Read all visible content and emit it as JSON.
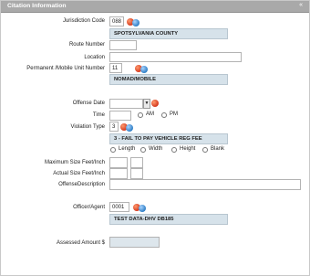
{
  "panel": {
    "title": "Citation Information",
    "toggle": "«"
  },
  "jurisdiction": {
    "label": "Jurisdiction Code",
    "code": "088",
    "name": "SPOTSYLVANIA COUNTY"
  },
  "route": {
    "label": "Route Number",
    "value": ""
  },
  "location": {
    "label": "Location",
    "value": ""
  },
  "unit": {
    "label": "Permanent /Mobile Unit Number",
    "code": "11",
    "name": "NOMAD/MOBILE"
  },
  "offense_date": {
    "label": "Offense Date",
    "value": ""
  },
  "time": {
    "label": "Time",
    "value": "",
    "am": "AM",
    "pm": "PM"
  },
  "violation": {
    "label": "Violation Type",
    "code": "3",
    "desc": "3 - FAIL TO PAY VEHICLE REG FEE"
  },
  "size_options": [
    "Length",
    "Width",
    "Height",
    "Blank"
  ],
  "max_size": {
    "label": "Maximum Size Feet/Inch"
  },
  "actual_size": {
    "label": "Actual Size Feet/Inch"
  },
  "offense_desc": {
    "label": "OffenseDescription",
    "value": ""
  },
  "officer": {
    "label": "Officer/Agent",
    "code": "0001",
    "name": "TEST DATA-DHV DB185"
  },
  "assessed": {
    "label": "Assessed Amount $",
    "value": ""
  },
  "icons": {
    "lookup": "lookup-icon",
    "info": "info-icon",
    "calendar": "calendar-dropdown-icon"
  },
  "colors": {
    "header": "#a9a9a9",
    "band": "#d6e2ea",
    "accent_red": "#d4381e"
  }
}
